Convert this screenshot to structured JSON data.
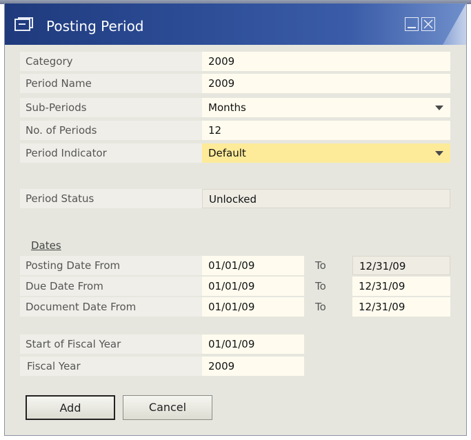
{
  "window": {
    "title": "Posting Period"
  },
  "header": {
    "category": {
      "label": "Category",
      "value": "2009"
    },
    "period_name": {
      "label": "Period Name",
      "value": "2009"
    },
    "sub_periods": {
      "label": "Sub-Periods",
      "value": "Months"
    },
    "num_periods": {
      "label": "No. of Periods",
      "value": "12"
    },
    "period_indicator": {
      "label": "Period Indicator",
      "value": "Default"
    },
    "period_status": {
      "label": "Period Status",
      "value": "Unlocked"
    }
  },
  "dates": {
    "section_label": "Dates",
    "to_label": "To",
    "posting": {
      "label": "Posting Date From",
      "from": "01/01/09",
      "to": "12/31/09"
    },
    "due": {
      "label": "Due Date From",
      "from": "01/01/09",
      "to": "12/31/09"
    },
    "document": {
      "label": "Document Date From",
      "from": "01/01/09",
      "to": "12/31/09"
    }
  },
  "fiscal": {
    "start": {
      "label": "Start of Fiscal Year",
      "value": "01/01/09"
    },
    "year": {
      "label": "Fiscal Year",
      "value": "2009"
    }
  },
  "buttons": {
    "add": "Add",
    "cancel": "Cancel"
  },
  "colors": {
    "title_bar": "#2a4a93",
    "form_background": "#e6e6de",
    "field_background": "#fffcef",
    "highlight_field": "#fdeb99"
  },
  "icons": {
    "title": "window-form-icon",
    "minimize": "minimize-icon",
    "close": "close-icon",
    "dropdown": "chevron-down-icon"
  }
}
